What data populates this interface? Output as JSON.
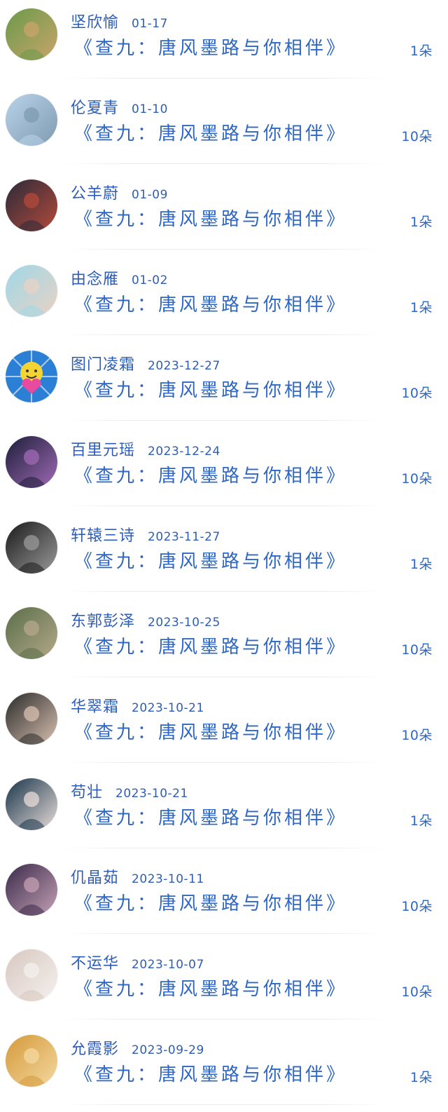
{
  "items": [
    {
      "name": "坚欣愉",
      "date": "01-17",
      "title": "《查九：唐风墨路与你相伴》",
      "count": "1朵",
      "avatar_icon": "landscape-avatar",
      "colors": [
        "#6a9a4a",
        "#c9a46a"
      ]
    },
    {
      "name": "伦夏青",
      "date": "01-10",
      "title": "《查九：唐风墨路与你相伴》",
      "count": "10朵",
      "avatar_icon": "seaside-avatar",
      "colors": [
        "#b9d3ea",
        "#7f9bb1"
      ]
    },
    {
      "name": "公羊蔚",
      "date": "01-09",
      "title": "《查九：唐风墨路与你相伴》",
      "count": "1朵",
      "avatar_icon": "group-photo-avatar",
      "colors": [
        "#2a2a3a",
        "#b44a3a"
      ]
    },
    {
      "name": "由念雁",
      "date": "01-02",
      "title": "《查九：唐风墨路与你相伴》",
      "count": "1朵",
      "avatar_icon": "girl-portrait-avatar",
      "colors": [
        "#9ed8e8",
        "#e8d2c4"
      ]
    },
    {
      "name": "图门凌霜",
      "date": "2023-12-27",
      "title": "《查九：唐风墨路与你相伴》",
      "count": "10朵",
      "avatar_icon": "smiley-heart-avatar",
      "colors": [
        "#2b7fd4",
        "#f3d432"
      ]
    },
    {
      "name": "百里元瑶",
      "date": "2023-12-24",
      "title": "《查九：唐风墨路与你相伴》",
      "count": "10朵",
      "avatar_icon": "stage-avatar",
      "colors": [
        "#1c1e3a",
        "#a06ab4"
      ]
    },
    {
      "name": "轩辕三诗",
      "date": "2023-11-27",
      "title": "《查九：唐风墨路与你相伴》",
      "count": "1朵",
      "avatar_icon": "monochrome-profile-avatar",
      "colors": [
        "#1a1a1a",
        "#9a9a9a"
      ]
    },
    {
      "name": "东郭彭泽",
      "date": "2023-10-25",
      "title": "《查九：唐风墨路与你相伴》",
      "count": "10朵",
      "avatar_icon": "outdoor-sitting-avatar",
      "colors": [
        "#5a6e48",
        "#b4a88a"
      ]
    },
    {
      "name": "华翠霜",
      "date": "2023-10-21",
      "title": "《查九：唐风墨路与你相伴》",
      "count": "10朵",
      "avatar_icon": "cap-portrait-avatar",
      "colors": [
        "#2a2a2a",
        "#d8c0b0"
      ]
    },
    {
      "name": "苟壮",
      "date": "2023-10-21",
      "title": "《查九：唐风墨路与你相伴》",
      "count": "1朵",
      "avatar_icon": "lady-flower-avatar",
      "colors": [
        "#17344a",
        "#e8dcd8"
      ]
    },
    {
      "name": "仉晶茹",
      "date": "2023-10-11",
      "title": "《查九：唐风墨路与你相伴》",
      "count": "10朵",
      "avatar_icon": "singer-avatar",
      "colors": [
        "#3a2a4a",
        "#c4a0b4"
      ]
    },
    {
      "name": "不运华",
      "date": "2023-10-07",
      "title": "《查九：唐风墨路与你相伴》",
      "count": "10朵",
      "avatar_icon": "child-rabbit-avatar",
      "colors": [
        "#d8c8c0",
        "#f4f0ee"
      ]
    },
    {
      "name": "允霞影",
      "date": "2023-09-29",
      "title": "《查九：唐风墨路与你相伴》",
      "count": "1朵",
      "avatar_icon": "golden-hand-avatar",
      "colors": [
        "#d49a3a",
        "#f4d8a0"
      ]
    }
  ]
}
